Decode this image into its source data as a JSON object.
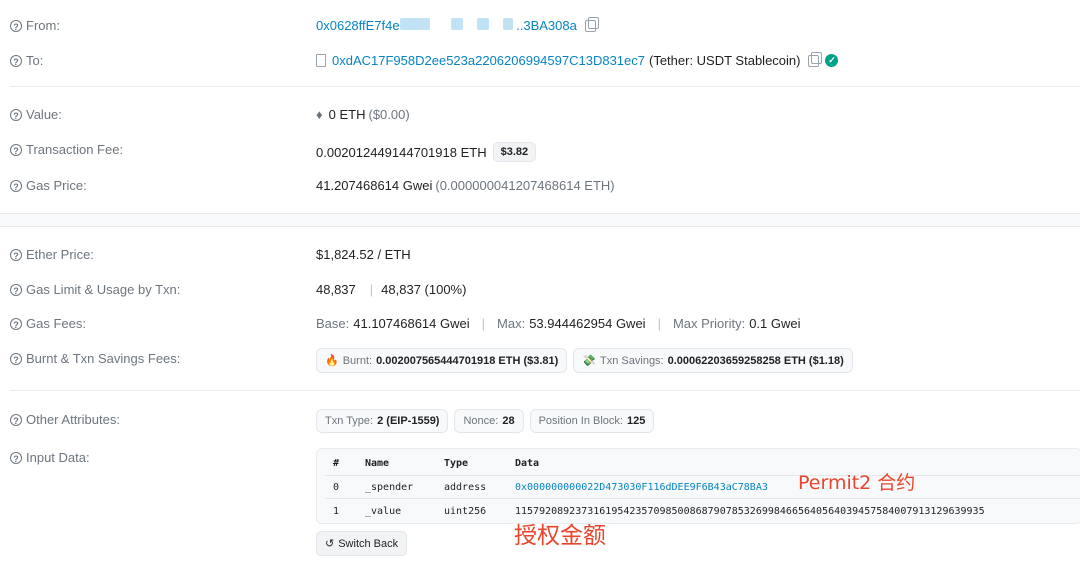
{
  "rows": {
    "from": {
      "label": "From:",
      "addr_start": "0x0628ffE7f4e",
      "addr_end": "..3BA308a"
    },
    "to": {
      "label": "To:",
      "address": "0xdAC17F958D2ee523a2206206994597C13D831ec7",
      "name": "(Tether: USDT Stablecoin)"
    },
    "value": {
      "label": "Value:",
      "icon": "eth-icon",
      "amount": "0 ETH",
      "usd": "($0.00)"
    },
    "fee": {
      "label": "Transaction Fee:",
      "amount": "0.002012449144701918 ETH",
      "usd": "$3.82"
    },
    "gas_price": {
      "label": "Gas Price:",
      "gwei": "41.207468614 Gwei",
      "eth": "(0.000000041207468614 ETH)"
    },
    "ether_price": {
      "label": "Ether Price:",
      "value": "$1,824.52 / ETH"
    },
    "gas_limit": {
      "label": "Gas Limit & Usage by Txn:",
      "limit": "48,837",
      "usage": "48,837 (100%)"
    },
    "gas_fees": {
      "label": "Gas Fees:",
      "base_label": "Base:",
      "base": "41.107468614 Gwei",
      "max_label": "Max:",
      "max": "53.944462954 Gwei",
      "prio_label": "Max Priority:",
      "prio": "0.1 Gwei"
    },
    "burnt": {
      "label": "Burnt & Txn Savings Fees:",
      "burnt_label": "Burnt:",
      "burnt": "0.002007565444701918 ETH ($3.81)",
      "savings_label": "Txn Savings:",
      "savings": "0.00062203659258258 ETH ($1.18)"
    },
    "other": {
      "label": "Other Attributes:",
      "type_label": "Txn Type:",
      "type": "2 (EIP-1559)",
      "nonce_label": "Nonce:",
      "nonce": "28",
      "pos_label": "Position In Block:",
      "pos": "125"
    },
    "input": {
      "label": "Input Data:"
    }
  },
  "input_table": {
    "headers": [
      "#",
      "Name",
      "Type",
      "Data"
    ],
    "rows": [
      {
        "idx": "0",
        "name": "_spender",
        "type": "address",
        "data": "0x000000000022D473030F116dDEE9F6B43aC78BA3"
      },
      {
        "idx": "1",
        "name": "_value",
        "type": "uint256",
        "data": "115792089237316195423570985008687907853269984665640564039457584007913129639935"
      }
    ]
  },
  "switch_back": "Switch Back",
  "annotations": {
    "permit2": "Permit2 合约",
    "amount": "授权金额"
  }
}
